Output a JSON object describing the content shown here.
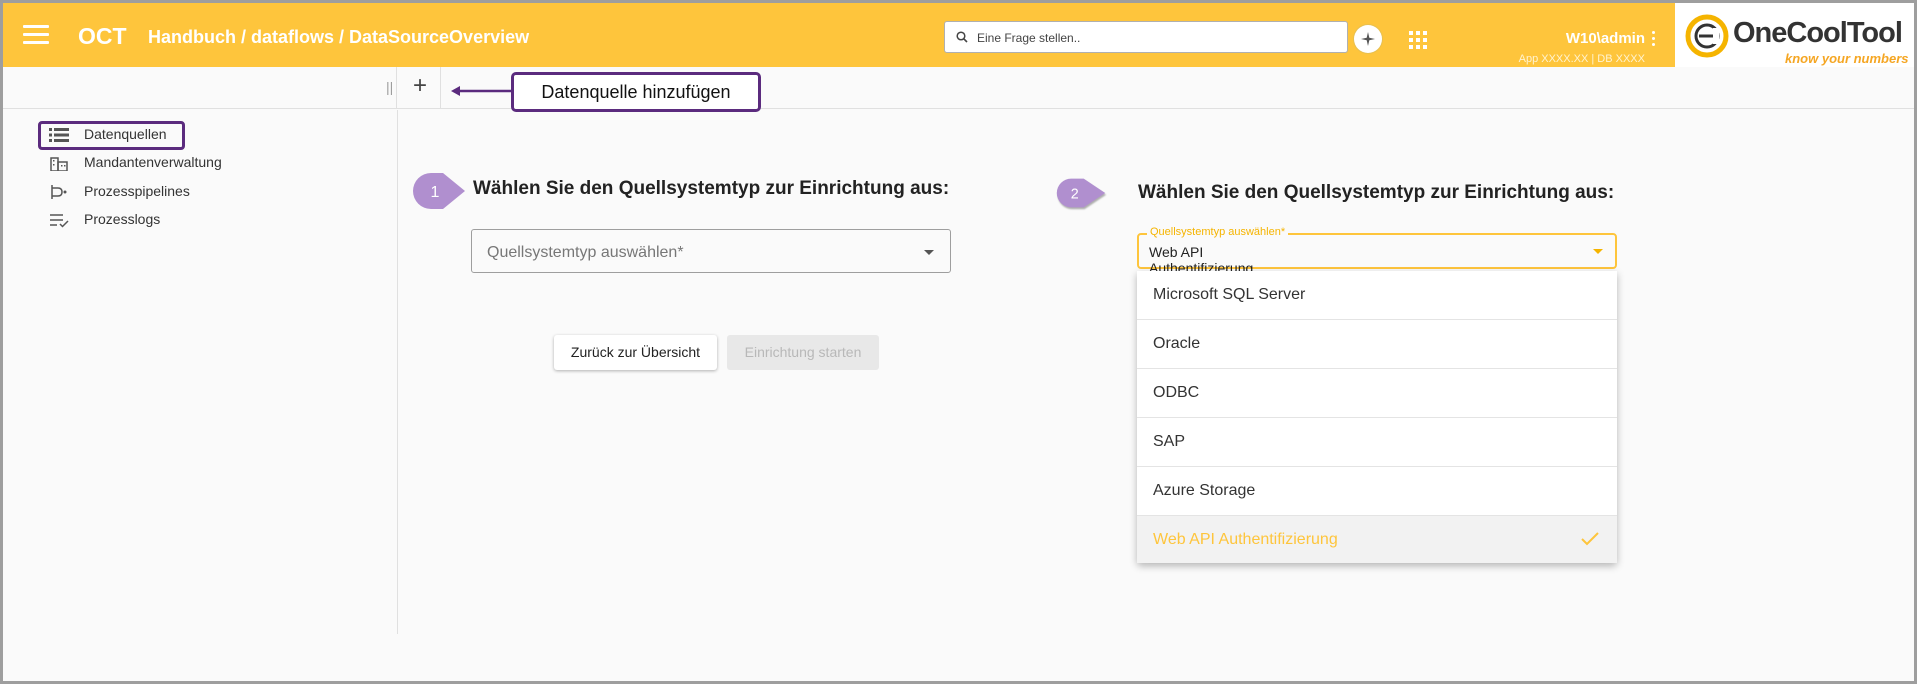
{
  "header": {
    "app_abbr": "OCT",
    "breadcrumb": "Handbuch / dataflows / DataSourceOverview",
    "search_placeholder": "Eine Frage stellen..",
    "user_name": "W10\\admin",
    "app_info": "App XXXX.XX | DB XXXX",
    "logo_text": "OneCoolTool",
    "logo_tagline": "know your numbers",
    "accent_color": "#fec53c"
  },
  "toolbar": {
    "add_label": "+",
    "callout": "Datenquelle hinzufügen"
  },
  "sidebar": {
    "items": [
      {
        "label": "Datenquellen",
        "icon": "list-database-icon"
      },
      {
        "label": "Mandantenverwaltung",
        "icon": "buildings-icon"
      },
      {
        "label": "Prozesspipelines",
        "icon": "pipeline-icon"
      },
      {
        "label": "Prozesslogs",
        "icon": "checklist-icon"
      }
    ]
  },
  "step1": {
    "badge": "1",
    "title": "Wählen Sie den Quellsystemtyp zur Einrichtung aus:",
    "select_placeholder": "Quellsystemtyp auswählen*",
    "back_button": "Zurück zur Übersicht",
    "start_button": "Einrichtung starten"
  },
  "step2": {
    "badge": "2",
    "title": "Wählen Sie den Quellsystemtyp zur Einrichtung aus:",
    "select_label": "Quellsystemtyp auswählen*",
    "selected_value": "Web API Authentifizierung",
    "options": [
      "Microsoft SQL Server",
      "Oracle",
      "ODBC",
      "SAP",
      "Azure Storage",
      "Web API Authentifizierung"
    ]
  },
  "colors": {
    "annotation": "#5b2b7e",
    "badge": "#b08fcf"
  }
}
